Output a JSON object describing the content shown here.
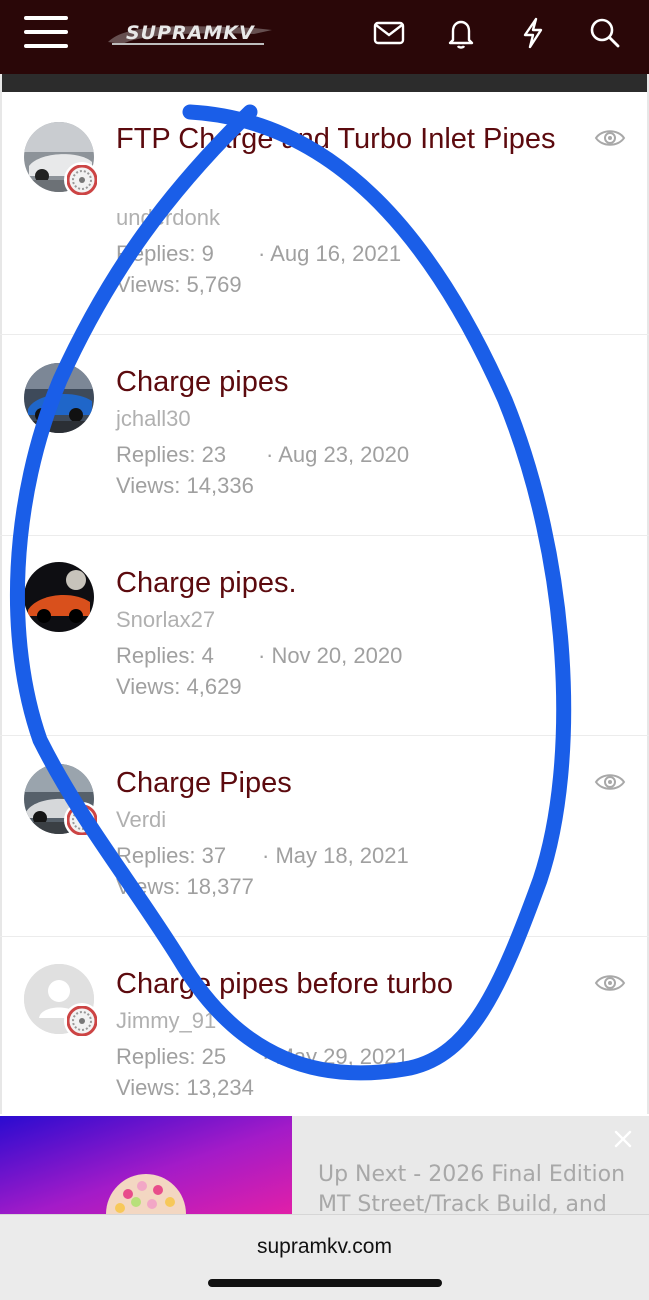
{
  "header": {
    "logo_text": "SUPRAMKV",
    "icons": [
      "menu-icon",
      "mail-icon",
      "bell-icon",
      "lightning-icon",
      "search-icon"
    ],
    "background": "#2a0708"
  },
  "threads": [
    {
      "title": "FTP Charge and Turbo Inlet Pipes",
      "author": "underdonk",
      "replies": "Replies: 9",
      "date": "· Aug 16, 2021",
      "views": "Views: 5,769",
      "watched": true,
      "avatar": "white-car-photo"
    },
    {
      "title": "Charge pipes",
      "author": "jchall30",
      "replies": "Replies: 23",
      "date": "· Aug 23, 2020",
      "views": "Views: 14,336",
      "watched": false,
      "avatar": "blue-car-photo"
    },
    {
      "title": "Charge pipes.",
      "author": "Snorlax27",
      "replies": "Replies: 4",
      "date": "· Nov 20, 2020",
      "views": "Views: 4,629",
      "watched": false,
      "avatar": "orange-car-photo"
    },
    {
      "title": "Charge Pipes",
      "author": "Verdi",
      "replies": "Replies: 37",
      "date": "· May 18, 2021",
      "views": "Views: 18,377",
      "watched": true,
      "avatar": "street-car-photo"
    },
    {
      "title": "Charge pipes before turbo",
      "author": "Jimmy_91",
      "replies": "Replies: 25",
      "date": "· May 29, 2021",
      "views": "Views: 13,234",
      "watched": true,
      "avatar": "default-user"
    }
  ],
  "ad": {
    "text": "Up Next - 2026 Final Edition MT Street/Track Build, and"
  },
  "browser": {
    "url": "supramkv.com"
  },
  "colors": {
    "title": "#5c0a0e",
    "muted": "#a0a0a0",
    "annotation": "#1a5ee8"
  }
}
